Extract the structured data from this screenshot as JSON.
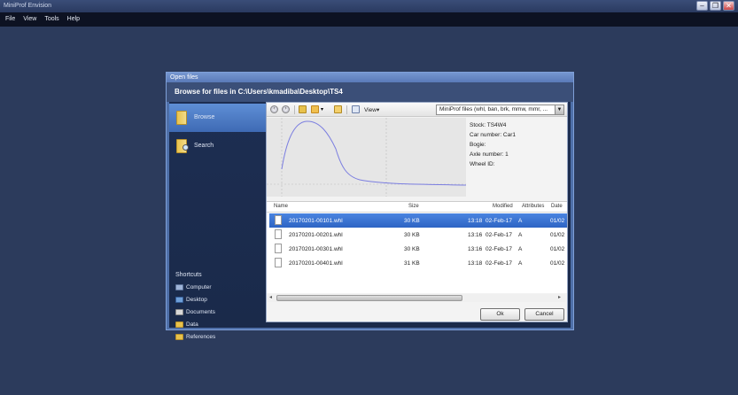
{
  "app": {
    "title": "MiniProf Envision",
    "controls": {
      "minimize": "–",
      "restore": "❐",
      "close": "✕"
    }
  },
  "menu": [
    "File",
    "View",
    "Tools",
    "Help"
  ],
  "dialog": {
    "title": "Open files",
    "header": "Browse for files in C:\\Users\\kmadiba\\Desktop\\TS4",
    "sidebar": {
      "browse": "Browse",
      "search": "Search",
      "shortcuts_title": "Shortcuts",
      "shortcuts": [
        "Computer",
        "Desktop",
        "Documents",
        "Data",
        "References"
      ]
    },
    "toolbar": {
      "view_label": "View",
      "filetype": "MiniProf files (whl, ban, brk, mmw, mmr, ..."
    },
    "preview": {
      "stock": "Stock: TS4W4",
      "car_number": "Car number: Car1",
      "bogie": "Bogie:",
      "axle_number": "Axle number: 1",
      "wheel_id": "Wheel ID:"
    },
    "columns": {
      "name": "Name",
      "size": "Size",
      "modified": "Modified",
      "attributes": "Attributes",
      "date": "Date"
    },
    "files": [
      {
        "name": "20170201-00101.whl",
        "size": "30 KB",
        "time": "13:18",
        "modified": "02-Feb-17",
        "attr": "A",
        "date": "01/02"
      },
      {
        "name": "20170201-00201.whl",
        "size": "30 KB",
        "time": "13:16",
        "modified": "02-Feb-17",
        "attr": "A",
        "date": "01/02"
      },
      {
        "name": "20170201-00301.whl",
        "size": "30 KB",
        "time": "13:16",
        "modified": "02-Feb-17",
        "attr": "A",
        "date": "01/02"
      },
      {
        "name": "20170201-00401.whl",
        "size": "31 KB",
        "time": "13:18",
        "modified": "02-Feb-17",
        "attr": "A",
        "date": "01/02"
      }
    ],
    "buttons": {
      "ok": "Ok",
      "cancel": "Cancel"
    }
  }
}
